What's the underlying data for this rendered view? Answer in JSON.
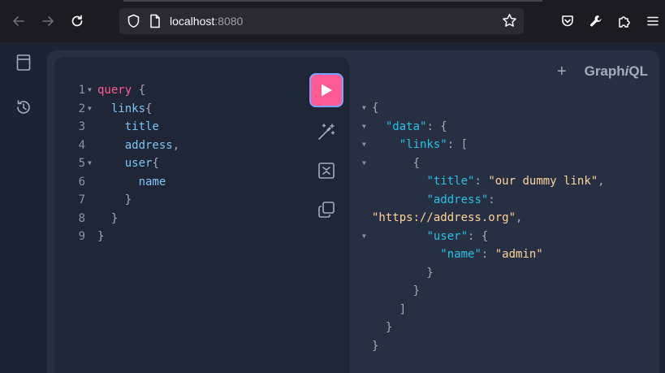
{
  "browser": {
    "url_host": "localhost",
    "url_port": ":8080"
  },
  "graphiql": {
    "brand_prefix": "Graph",
    "brand_i": "i",
    "brand_suffix": "QL",
    "plus_label": "+"
  },
  "query_lines": [
    {
      "num": "1",
      "fold": "▼",
      "tokens": [
        {
          "t": "query",
          "c": "kw"
        },
        {
          "t": " {",
          "c": "punc"
        }
      ]
    },
    {
      "num": "2",
      "fold": "▼",
      "tokens": [
        {
          "t": "  links",
          "c": "fld"
        },
        {
          "t": "{",
          "c": "punc"
        }
      ]
    },
    {
      "num": "3",
      "fold": "",
      "tokens": [
        {
          "t": "    title",
          "c": "fld"
        }
      ]
    },
    {
      "num": "4",
      "fold": "",
      "tokens": [
        {
          "t": "    address",
          "c": "fld"
        },
        {
          "t": ",",
          "c": "punc"
        }
      ]
    },
    {
      "num": "5",
      "fold": "▼",
      "tokens": [
        {
          "t": "    user",
          "c": "fld"
        },
        {
          "t": "{",
          "c": "punc"
        }
      ]
    },
    {
      "num": "6",
      "fold": "",
      "tokens": [
        {
          "t": "      name",
          "c": "fld"
        }
      ]
    },
    {
      "num": "7",
      "fold": "",
      "tokens": [
        {
          "t": "    }",
          "c": "punc"
        }
      ]
    },
    {
      "num": "8",
      "fold": "",
      "tokens": [
        {
          "t": "  }",
          "c": "punc"
        }
      ]
    },
    {
      "num": "9",
      "fold": "",
      "tokens": [
        {
          "t": "}",
          "c": "punc"
        }
      ]
    }
  ],
  "result_lines": [
    {
      "fold": "▼",
      "tokens": [
        {
          "t": "{",
          "c": "punc"
        }
      ]
    },
    {
      "fold": "▼",
      "tokens": [
        {
          "t": "  ",
          "c": "punc"
        },
        {
          "t": "\"data\"",
          "c": "key"
        },
        {
          "t": ": {",
          "c": "punc"
        }
      ]
    },
    {
      "fold": "▼",
      "tokens": [
        {
          "t": "    ",
          "c": "punc"
        },
        {
          "t": "\"links\"",
          "c": "key"
        },
        {
          "t": ": [",
          "c": "punc"
        }
      ]
    },
    {
      "fold": "▼",
      "tokens": [
        {
          "t": "      {",
          "c": "punc"
        }
      ]
    },
    {
      "fold": "",
      "tokens": [
        {
          "t": "        ",
          "c": "punc"
        },
        {
          "t": "\"title\"",
          "c": "key"
        },
        {
          "t": ": ",
          "c": "punc"
        },
        {
          "t": "\"our dummy link\"",
          "c": "str"
        },
        {
          "t": ",",
          "c": "punc"
        }
      ]
    },
    {
      "fold": "",
      "tokens": [
        {
          "t": "        ",
          "c": "punc"
        },
        {
          "t": "\"address\"",
          "c": "key"
        },
        {
          "t": ":",
          "c": "punc"
        }
      ]
    },
    {
      "fold": "",
      "tokens": [
        {
          "t": "\"https://address.org\"",
          "c": "str"
        },
        {
          "t": ",",
          "c": "punc"
        }
      ]
    },
    {
      "fold": "▼",
      "tokens": [
        {
          "t": "        ",
          "c": "punc"
        },
        {
          "t": "\"user\"",
          "c": "key"
        },
        {
          "t": ": {",
          "c": "punc"
        }
      ]
    },
    {
      "fold": "",
      "tokens": [
        {
          "t": "          ",
          "c": "punc"
        },
        {
          "t": "\"name\"",
          "c": "key"
        },
        {
          "t": ": ",
          "c": "punc"
        },
        {
          "t": "\"admin\"",
          "c": "str"
        }
      ]
    },
    {
      "fold": "",
      "tokens": [
        {
          "t": "        }",
          "c": "punc"
        }
      ]
    },
    {
      "fold": "",
      "tokens": [
        {
          "t": "      }",
          "c": "punc"
        }
      ]
    },
    {
      "fold": "",
      "tokens": [
        {
          "t": "    ]",
          "c": "punc"
        }
      ]
    },
    {
      "fold": "",
      "tokens": [
        {
          "t": "  }",
          "c": "punc"
        }
      ]
    },
    {
      "fold": "",
      "tokens": [
        {
          "t": "}",
          "c": "punc"
        }
      ]
    }
  ],
  "icons": {
    "back": "arrow-left-icon",
    "forward": "arrow-right-icon",
    "reload": "reload-icon",
    "shield": "shield-icon",
    "page": "page-icon",
    "star": "star-icon",
    "pocket": "pocket-icon",
    "tools": "wrench-icon",
    "extensions": "puzzle-icon",
    "menu": "hamburger-menu-icon",
    "docs": "docs-icon",
    "history": "history-icon",
    "run": "play-icon",
    "prettify": "prettify-icon",
    "merge": "merge-icon",
    "copy": "copy-icon"
  },
  "colors": {
    "run_button": "#ff5a94",
    "keyword": "#ff5a94",
    "field": "#7cc3f5",
    "json_key": "#29c1e6",
    "json_string": "#ffd39a"
  }
}
